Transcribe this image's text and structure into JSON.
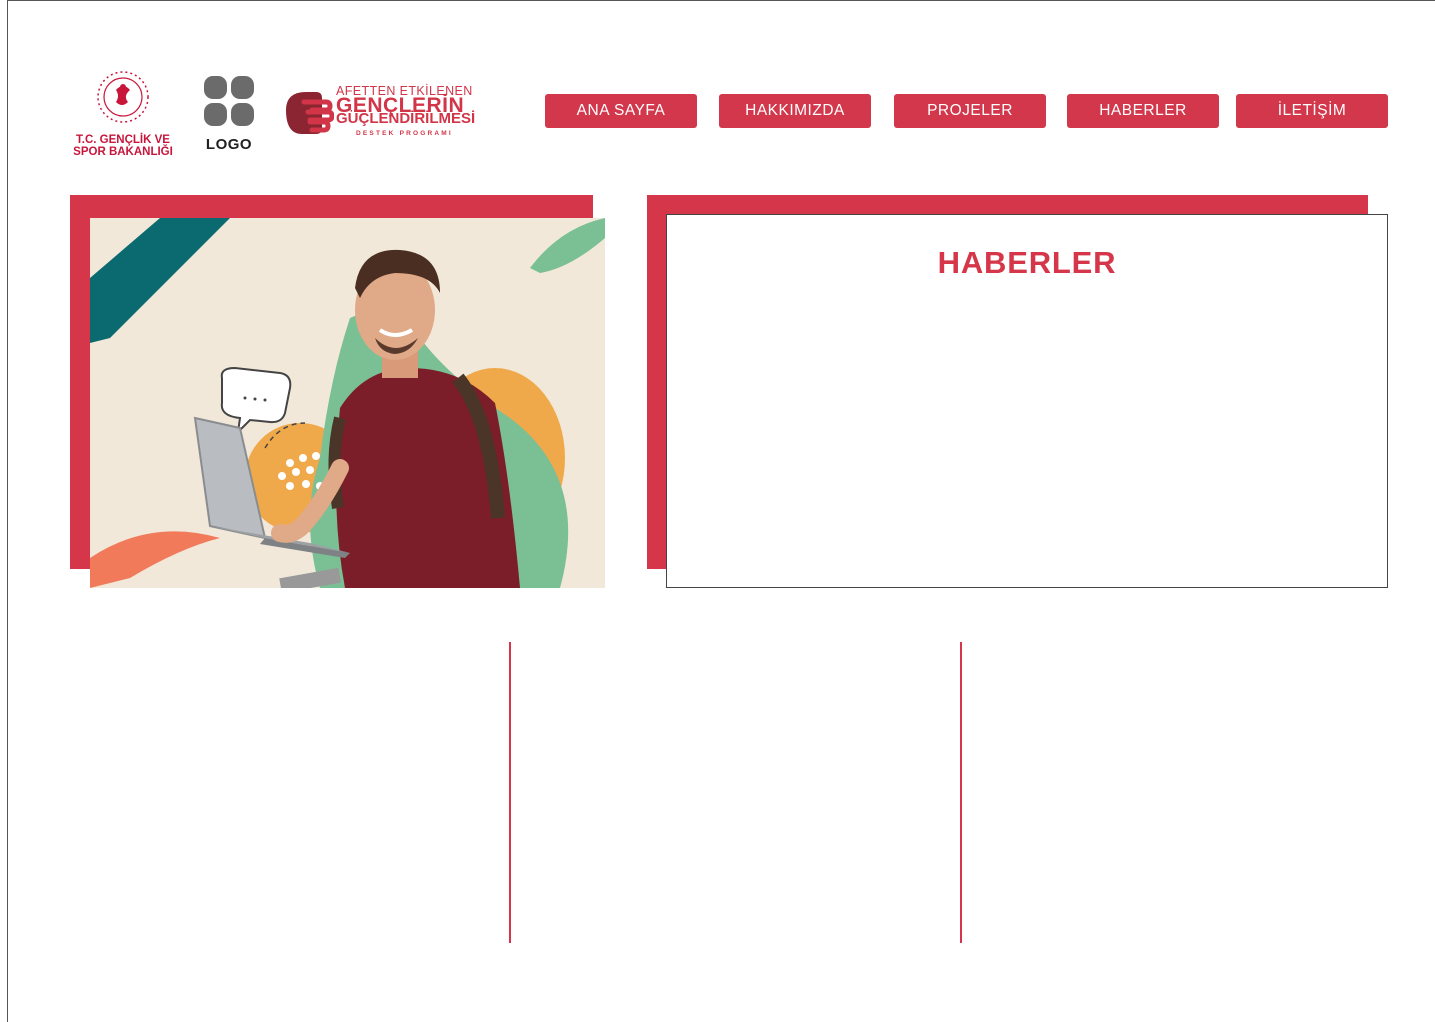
{
  "logos": {
    "ministry": {
      "line1": "T.C. GENÇLİK VE",
      "line2": "SPOR BAKANLIĞI"
    },
    "generic": {
      "label": "LOGO"
    },
    "program": {
      "line1": "AFETTEN ETKİLENEN",
      "line2": "GENÇLERİN",
      "line3": "GÜÇLENDİRİLMESİ",
      "line4": "DESTEK PROGRAMI"
    }
  },
  "nav": {
    "items": [
      {
        "label": "ANA SAYFA"
      },
      {
        "label": "HAKKIMIZDA"
      },
      {
        "label": "PROJELER"
      },
      {
        "label": "HABERLER"
      },
      {
        "label": "İLETİŞİM"
      }
    ]
  },
  "news": {
    "title": "HABERLER"
  },
  "colors": {
    "accent": "#d53649",
    "teal": "#0b6a6f",
    "green": "#7bbf94",
    "orange": "#f0a94a"
  }
}
